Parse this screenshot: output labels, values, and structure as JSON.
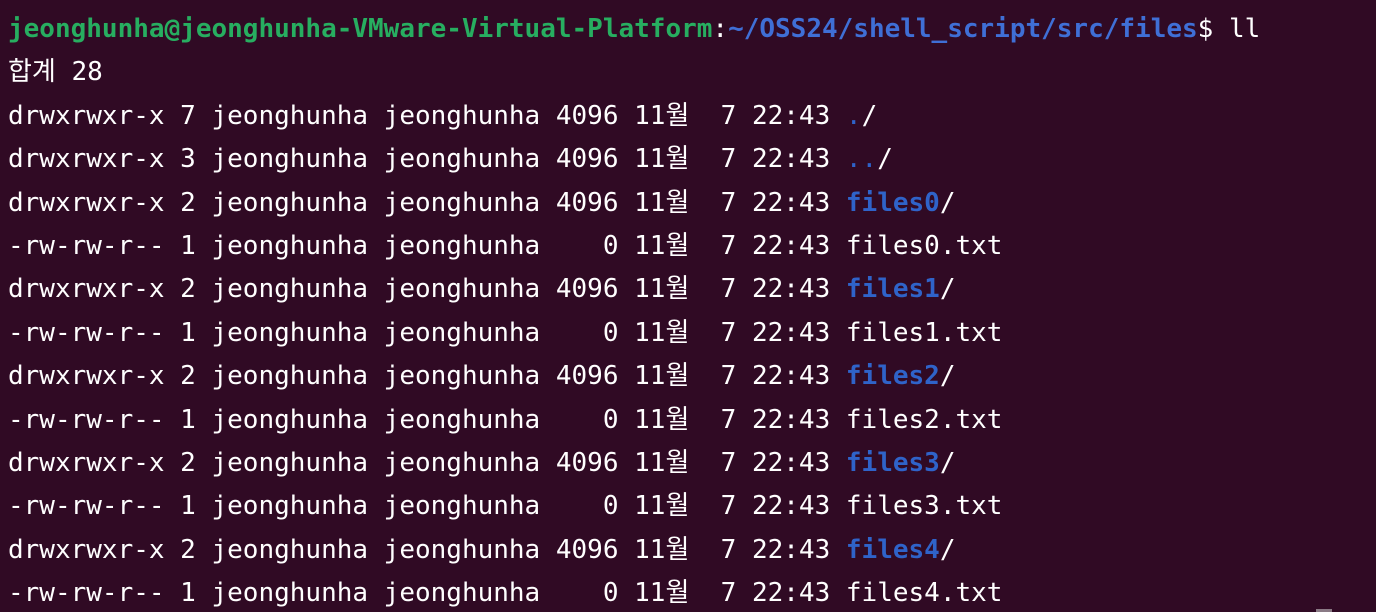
{
  "prompt": {
    "user_host": "jeonghunha@jeonghunha-VMware-Virtual-Platform",
    "colon": ":",
    "path": "~/OSS24/shell_script/src/files",
    "dollar": "$",
    "command": " ll"
  },
  "total_line": "합계 28",
  "entries": [
    {
      "meta": "drwxrwxr-x 7 jeonghunha jeonghunha 4096 11월  7 22:43 ",
      "name": ".",
      "suffix": "/",
      "type": "dotdir"
    },
    {
      "meta": "drwxrwxr-x 3 jeonghunha jeonghunha 4096 11월  7 22:43 ",
      "name": "..",
      "suffix": "/",
      "type": "dotdir"
    },
    {
      "meta": "drwxrwxr-x 2 jeonghunha jeonghunha 4096 11월  7 22:43 ",
      "name": "files0",
      "suffix": "/",
      "type": "dir"
    },
    {
      "meta": "-rw-rw-r-- 1 jeonghunha jeonghunha    0 11월  7 22:43 ",
      "name": "files0.txt",
      "suffix": "",
      "type": "file"
    },
    {
      "meta": "drwxrwxr-x 2 jeonghunha jeonghunha 4096 11월  7 22:43 ",
      "name": "files1",
      "suffix": "/",
      "type": "dir"
    },
    {
      "meta": "-rw-rw-r-- 1 jeonghunha jeonghunha    0 11월  7 22:43 ",
      "name": "files1.txt",
      "suffix": "",
      "type": "file"
    },
    {
      "meta": "drwxrwxr-x 2 jeonghunha jeonghunha 4096 11월  7 22:43 ",
      "name": "files2",
      "suffix": "/",
      "type": "dir"
    },
    {
      "meta": "-rw-rw-r-- 1 jeonghunha jeonghunha    0 11월  7 22:43 ",
      "name": "files2.txt",
      "suffix": "",
      "type": "file"
    },
    {
      "meta": "drwxrwxr-x 2 jeonghunha jeonghunha 4096 11월  7 22:43 ",
      "name": "files3",
      "suffix": "/",
      "type": "dir"
    },
    {
      "meta": "-rw-rw-r-- 1 jeonghunha jeonghunha    0 11월  7 22:43 ",
      "name": "files3.txt",
      "suffix": "",
      "type": "file"
    },
    {
      "meta": "drwxrwxr-x 2 jeonghunha jeonghunha 4096 11월  7 22:43 ",
      "name": "files4",
      "suffix": "/",
      "type": "dir"
    },
    {
      "meta": "-rw-rw-r-- 1 jeonghunha jeonghunha    0 11월  7 22:43 ",
      "name": "files4.txt",
      "suffix": "",
      "type": "file"
    }
  ],
  "colors": {
    "background": "#300a24",
    "prompt_user": "#27ae60",
    "prompt_path": "#3f6fd6",
    "directory": "#2f63c9",
    "text": "#ffffff"
  }
}
